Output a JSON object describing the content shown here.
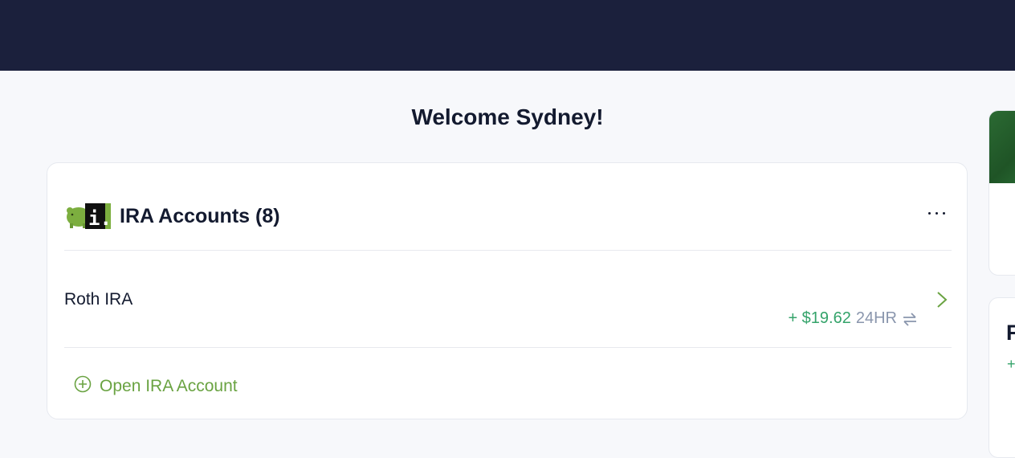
{
  "welcome": "Welcome Sydney!",
  "ira_card": {
    "title": "IRA Accounts (8)",
    "logo_text": "i.",
    "logo_icon": "piggy-bank-logo",
    "menu_icon": "more-horizontal-icon",
    "accounts": [
      {
        "name": "Roth IRA",
        "change_amount": "+ $19.62",
        "change_period": "24HR",
        "swap_icon": "swap-arrows-icon",
        "chevron_icon": "chevron-right-icon"
      }
    ],
    "open_account_label": "Open IRA Account",
    "open_account_icon": "plus-circle-icon"
  },
  "side_card_2": {
    "title_partial": "F",
    "change_partial": "+"
  },
  "colors": {
    "topbar": "#1b203c",
    "accent_green": "#6aa342",
    "gain_green": "#34a36a",
    "muted": "#8a96ad",
    "text": "#131a2f"
  }
}
